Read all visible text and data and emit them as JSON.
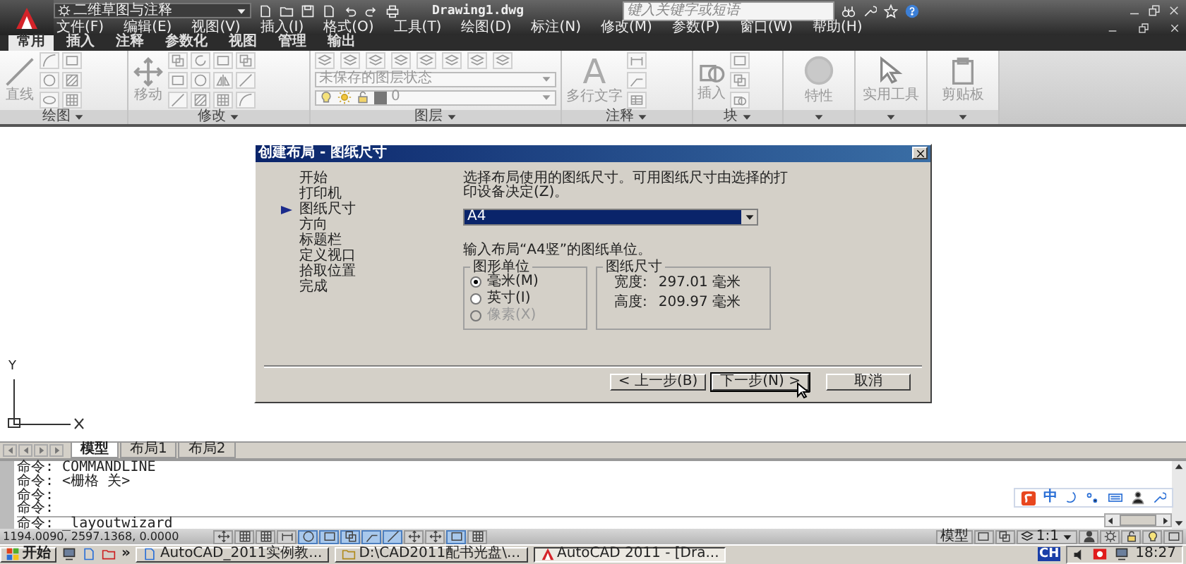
{
  "app": {
    "workspace": "二维草图与注释",
    "title": "Drawing1.dwg",
    "search": {
      "placeholder": "键入关键字或短语"
    }
  },
  "menu": [
    "文件(F)",
    "编辑(E)",
    "视图(V)",
    "插入(I)",
    "格式(O)",
    "工具(T)",
    "绘图(D)",
    "标注(N)",
    "修改(M)",
    "参数(P)",
    "窗口(W)",
    "帮助(H)"
  ],
  "ribbon_tabs": [
    {
      "label": "常用",
      "selected": true
    },
    {
      "label": "插入",
      "selected": false
    },
    {
      "label": "注释",
      "selected": false
    },
    {
      "label": "参数化",
      "selected": false
    },
    {
      "label": "视图",
      "selected": false
    },
    {
      "label": "管理",
      "selected": false
    },
    {
      "label": "输出",
      "selected": false
    }
  ],
  "ribbon_panels": [
    {
      "kind": "draw",
      "label": "绘图",
      "big": "直线"
    },
    {
      "kind": "modify",
      "label": "修改",
      "big": "移动"
    },
    {
      "kind": "layers",
      "label": "图层",
      "layer_state": "未保存的图层状态",
      "layer": "0"
    },
    {
      "kind": "annotation",
      "label": "注释",
      "big": "多行文字",
      "glyph": "A"
    },
    {
      "kind": "block",
      "label": "块",
      "big": "插入"
    },
    {
      "kind": "properties",
      "big": "特性"
    },
    {
      "kind": "utilities",
      "big": "实用工具"
    },
    {
      "kind": "clipboard",
      "big": "剪贴板"
    }
  ],
  "dialog": {
    "title": "创建布局 - 图纸尺寸",
    "steps": [
      {
        "label": "开始",
        "selected": false
      },
      {
        "label": "打印机",
        "selected": false
      },
      {
        "label": "图纸尺寸",
        "selected": true
      },
      {
        "label": "方向",
        "selected": false
      },
      {
        "label": "标题栏",
        "selected": false
      },
      {
        "label": "定义视口",
        "selected": false
      },
      {
        "label": "拾取位置",
        "selected": false
      },
      {
        "label": "完成",
        "selected": false
      }
    ],
    "prompt": "选择布局使用的图纸尺寸。可用图纸尺寸由选择的打印设备决定(Z)。",
    "paper": "A4",
    "units_prompt": "输入布局“A4竖”的图纸单位。",
    "units_group": "图形单位",
    "units": [
      {
        "label": "毫米(M)",
        "selected": true,
        "disabled": false
      },
      {
        "label": "英寸(I)",
        "selected": false,
        "disabled": false
      },
      {
        "label": "像素(X)",
        "selected": false,
        "disabled": true
      }
    ],
    "size_group": "图纸尺寸",
    "sizes": [
      {
        "label": "宽度:",
        "value": "297.01 毫米"
      },
      {
        "label": "高度:",
        "value": "209.97 毫米"
      }
    ],
    "buttons": [
      {
        "label": "< 上一步(B)",
        "kind": "back"
      },
      {
        "label": "下一步(N) >",
        "kind": "next"
      },
      {
        "label": "取消",
        "kind": "cancel"
      }
    ]
  },
  "ucs": {
    "y": "Y"
  },
  "layout_tabs": [
    {
      "label": "模型",
      "selected": true
    },
    {
      "label": "布局1",
      "selected": false
    },
    {
      "label": "布局2",
      "selected": false
    }
  ],
  "command_lines": [
    {
      "kind": "history",
      "text": "命令: COMMANDLINE"
    },
    {
      "kind": "history",
      "text": "命令:  <栅格 关>"
    },
    {
      "kind": "history",
      "text": "命令:"
    },
    {
      "kind": "history",
      "text": "命令:"
    },
    {
      "kind": "input",
      "text": "命令:  _layoutwizard"
    }
  ],
  "ime": {
    "mode": "中"
  },
  "status_bar": {
    "coordinates": "1194.0090, 2597.1368, 0.0000",
    "toggles": [
      {
        "on": false
      },
      {
        "on": false
      },
      {
        "on": false
      },
      {
        "on": false
      },
      {
        "on": true
      },
      {
        "on": true
      },
      {
        "on": true
      },
      {
        "on": true
      },
      {
        "on": true
      },
      {
        "on": false
      },
      {
        "on": false
      },
      {
        "on": true
      },
      {
        "on": false
      }
    ],
    "space": "模型",
    "scale": "1:1"
  },
  "taskbar": {
    "start": "开始",
    "more": "»",
    "tasks": [
      {
        "label": "AutoCAD_2011实例教...",
        "kind": "document",
        "selected": false
      },
      {
        "label": "D:\\CAD2011配书光盘\\...",
        "kind": "folder",
        "selected": false
      },
      {
        "label": "AutoCAD 2011 - [Dra...",
        "kind": "app",
        "selected": true
      }
    ],
    "language": "CH",
    "clock": "18:27"
  }
}
